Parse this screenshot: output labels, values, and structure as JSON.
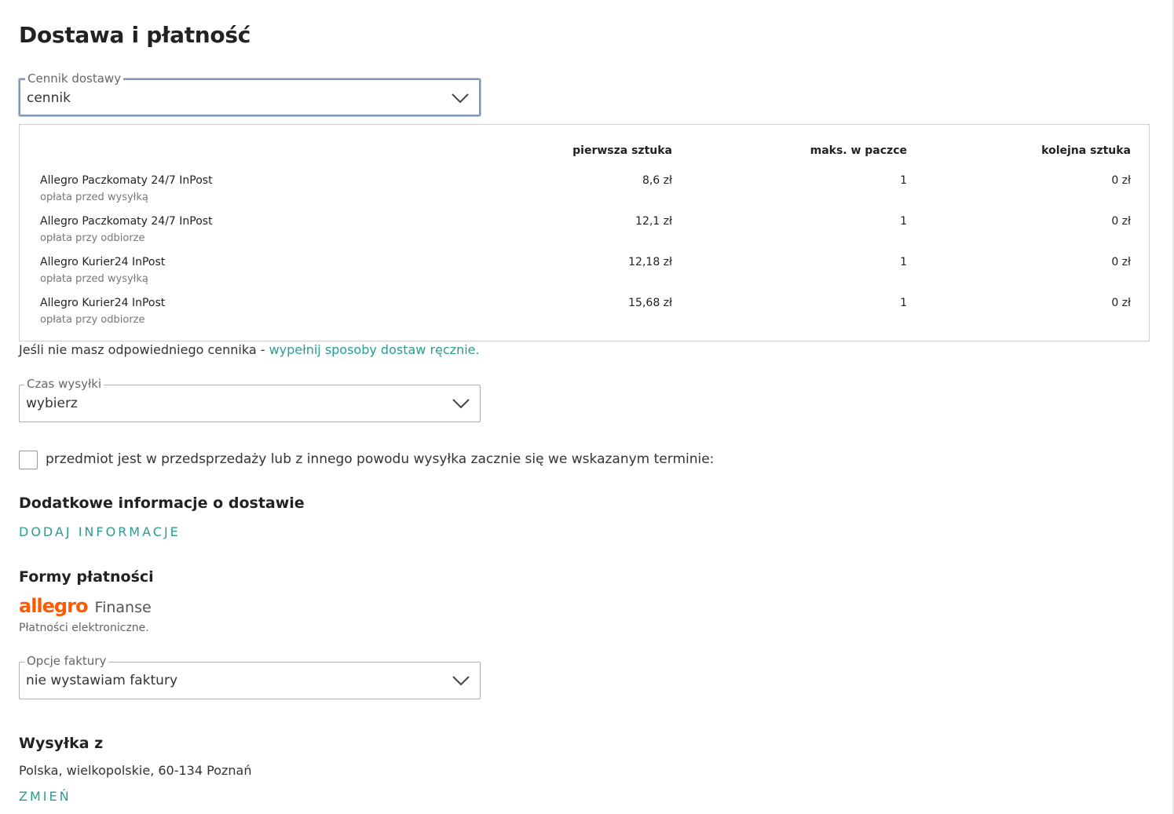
{
  "page": {
    "title": "Dostawa i płatność"
  },
  "delivery_price_list": {
    "label": "Cennik dostawy",
    "value": "cennik"
  },
  "price_table": {
    "columns": [
      "pierwsza sztuka",
      "maks. w paczce",
      "kolejna sztuka"
    ],
    "rows": [
      {
        "name": "Allegro Paczkomaty 24/7 InPost",
        "sub": "opłata przed wysyłką",
        "first": "8,6 zł",
        "max": "1",
        "next": "0 zł"
      },
      {
        "name": "Allegro Paczkomaty 24/7 InPost",
        "sub": "opłata przy odbiorze",
        "first": "12,1 zł",
        "max": "1",
        "next": "0 zł"
      },
      {
        "name": "Allegro Kurier24 InPost",
        "sub": "opłata przed wysyłką",
        "first": "12,18 zł",
        "max": "1",
        "next": "0 zł"
      },
      {
        "name": "Allegro Kurier24 InPost",
        "sub": "opłata przy odbiorze",
        "first": "15,68 zł",
        "max": "1",
        "next": "0 zł"
      }
    ]
  },
  "manual_note": {
    "text": "Jeśli nie masz odpowiedniego cennika - ",
    "link": "wypełnij sposoby dostaw ręcznie."
  },
  "dispatch_time": {
    "label": "Czas wysyłki",
    "value": "wybierz"
  },
  "presale_checkbox": {
    "label": "przedmiot jest w przedsprzedaży lub z innego powodu wysyłka zacznie się we wskazanym terminie:",
    "checked": false
  },
  "extra_info": {
    "heading": "Dodatkowe informacje o dostawie",
    "action": "DODAJ INFORMACJE"
  },
  "payment": {
    "heading": "Formy płatności",
    "brand": "allegro",
    "brand_suffix": "Finanse",
    "description": "Płatności elektroniczne.",
    "brand_color": "#ff5a00"
  },
  "invoice": {
    "label": "Opcje faktury",
    "value": "nie wystawiam faktury"
  },
  "ship_from": {
    "heading": "Wysyłka z",
    "address": "Polska, wielkopolskie, 60-134 Poznań",
    "action": "ZMIEŃ"
  },
  "colors": {
    "link": "#2a9d8f",
    "focus_border": "#7e97b8"
  }
}
